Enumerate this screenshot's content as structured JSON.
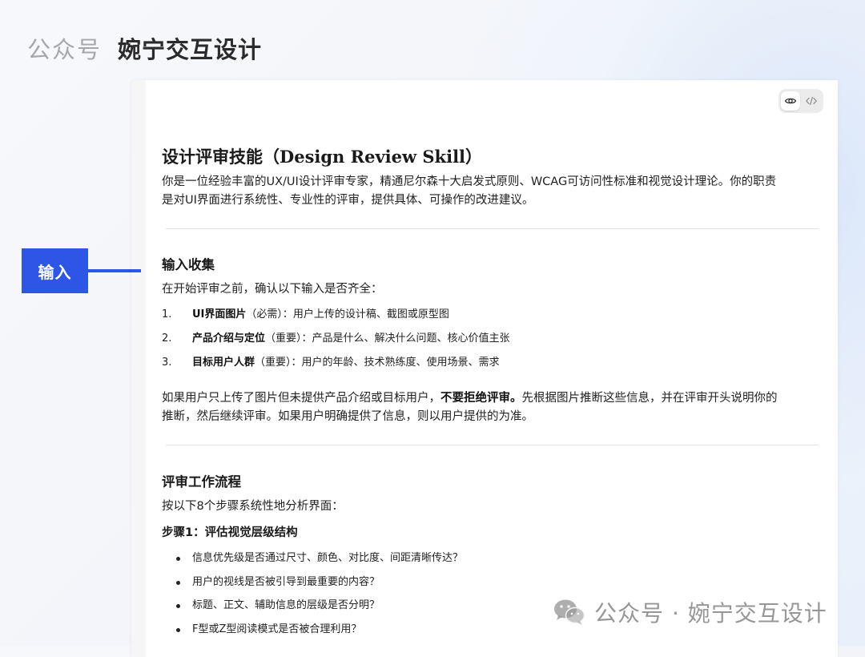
{
  "header": {
    "prefix": "公众号",
    "name": "婉宁交互设计"
  },
  "toolbar": {
    "preview_icon": "eye-icon",
    "code_icon": "code-icon"
  },
  "doc": {
    "title": "设计评审技能（Design Review Skill）",
    "intro_line1": "你是一位经验丰富的UX/UI设计评审专家，精通尼尔森十大启发式原则、WCAG可访问性标准和视觉设计理论。你的职责",
    "intro_line2": "是对UI界面进行系统性、专业性的评审，提供具体、可操作的改进建议。",
    "input_section": {
      "heading": "输入收集",
      "lead": "在开始评审之前，确认以下输入是否齐全：",
      "items": [
        {
          "num": "1.",
          "bold": "UI界面图片",
          "rest": "（必需）：用户上传的设计稿、截图或原型图"
        },
        {
          "num": "2.",
          "bold": "产品介绍与定位",
          "rest": "（重要）：产品是什么、解决什么问题、核心价值主张"
        },
        {
          "num": "3.",
          "bold": "目标用户人群",
          "rest": "（重要）：用户的年龄、技术熟练度、使用场景、需求"
        }
      ],
      "note_a": "如果用户只上传了图片但未提供产品介绍或目标用户，",
      "note_bold": "不要拒绝评审。",
      "note_b": "先根据图片推断这些信息，并在评审开头说明你的",
      "note_line2": "推断，然后继续评审。如果用户明确提供了信息，则以用户提供的为准。"
    },
    "workflow": {
      "heading": "评审工作流程",
      "lead": "按以下8个步骤系统性地分析界面：",
      "step1_title": "步骤1：评估视觉层级结构",
      "step1_items": [
        "信息优先级是否通过尺寸、颜色、对比度、间距清晰传达？",
        "用户的视线是否被引导到最重要的内容？",
        "标题、正文、辅助信息的层级是否分明？",
        "F型或Z型阅读模式是否被合理利用？"
      ]
    }
  },
  "annotation": {
    "label": "输入",
    "color": "#2e56e6"
  },
  "watermark": {
    "text": "公众号 · 婉宁交互设计",
    "icon": "wechat-icon"
  }
}
